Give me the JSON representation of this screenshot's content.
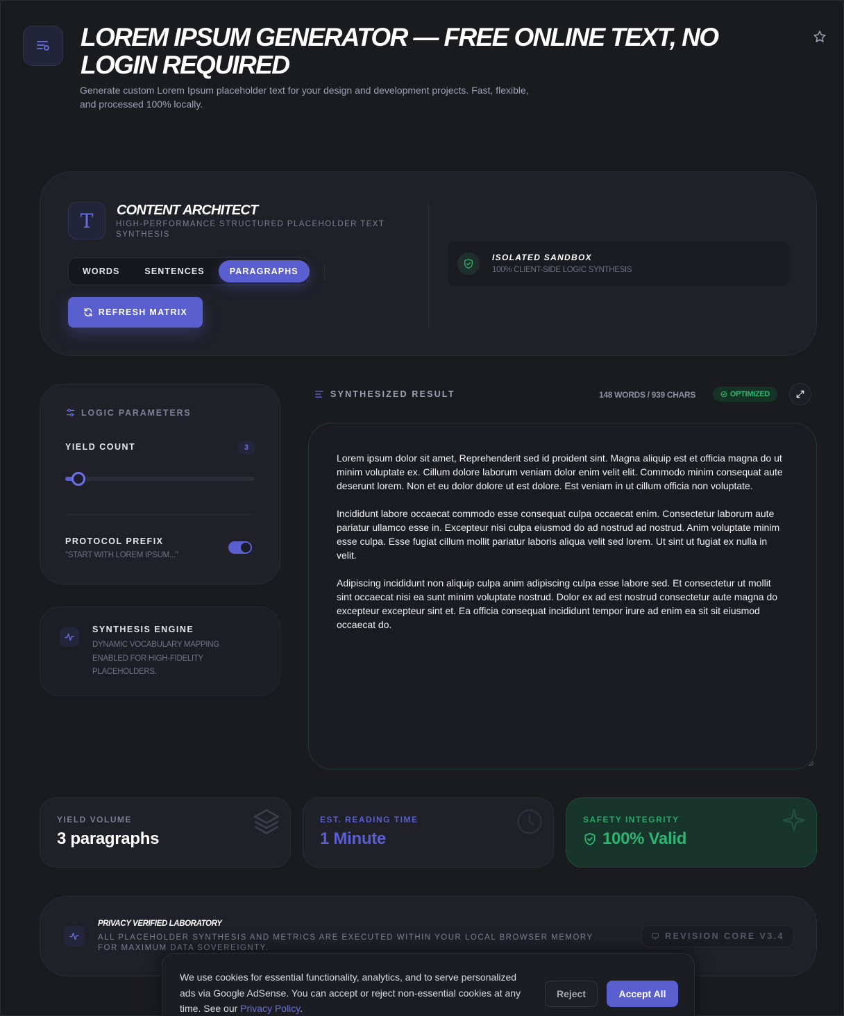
{
  "header": {
    "title": "LOREM IPSUM GENERATOR — FREE ONLINE TEXT, NO LOGIN REQUIRED",
    "subtitle": "Generate custom Lorem Ipsum placeholder text for your design and development projects. Fast, flexible, and processed 100% locally.",
    "menu_icon": "menu-lines-icon",
    "star_icon": "star-icon"
  },
  "architect": {
    "title": "CONTENT ARCHITECT",
    "subtitle": "HIGH-PERFORMANCE STRUCTURED PLACEHOLDER TEXT SYNTHESIS",
    "logo_glyph": "T",
    "tabs": [
      {
        "label": "WORDS",
        "active": false
      },
      {
        "label": "SENTENCES",
        "active": false
      },
      {
        "label": "PARAGRAPHS",
        "active": true
      }
    ],
    "refresh_label": "REFRESH MATRIX",
    "sandbox": {
      "title": "ISOLATED SANDBOX",
      "subtitle": "100% CLIENT-SIDE LOGIC SYNTHESIS"
    }
  },
  "logic": {
    "title": "LOGIC PARAMETERS",
    "yield_label": "YIELD COUNT",
    "yield_value": "3",
    "slider_fraction": 0.07,
    "prefix_label": "PROTOCOL PREFIX",
    "prefix_sub": "\"START WITH LOREM IPSUM...\"",
    "prefix_enabled": true
  },
  "engine": {
    "title": "SYNTHESIS ENGINE",
    "subtitle": "DYNAMIC VOCABULARY MAPPING ENABLED FOR HIGH-FIDELITY PLACEHOLDERS."
  },
  "result": {
    "title": "SYNTHESIZED RESULT",
    "stats": "148 WORDS / 939 CHARS",
    "badge": "OPTIMIZED",
    "paragraphs": [
      "Lorem ipsum dolor sit amet, Reprehenderit sed id proident sint. Magna aliquip est et officia magna do ut minim voluptate ex. Cillum dolore laborum veniam dolor enim velit elit. Commodo minim consequat aute deserunt lorem. Non et eu dolor dolore ut est dolore. Est veniam in ut cillum officia non voluptate.",
      "Incididunt labore occaecat commodo esse consequat culpa occaecat enim. Consectetur laborum aute pariatur ullamco esse in. Excepteur nisi culpa eiusmod do ad nostrud ad nostrud. Anim voluptate minim esse culpa. Esse fugiat cillum mollit pariatur laboris aliqua velit sed lorem. Ut sint ut fugiat ex nulla in velit.",
      "Adipiscing incididunt non aliquip culpa anim adipiscing culpa esse labore sed. Et consectetur ut mollit sint occaecat nisi ea sunt minim voluptate nostrud. Dolor ex ad est nostrud consectetur aute magna do excepteur excepteur sint et. Ea officia consequat incididunt tempor irure ad enim ea sit sit eiusmod occaecat do."
    ]
  },
  "stats": [
    {
      "label": "YIELD VOLUME",
      "value": "3 paragraphs",
      "icon": "layers-icon"
    },
    {
      "label": "EST. READING TIME",
      "value": "1 Minute",
      "icon": "clock-icon"
    },
    {
      "label": "SAFETY INTEGRITY",
      "value": "100% Valid",
      "icon": "sparkle-icon"
    }
  ],
  "footer": {
    "title": "PRIVACY VERIFIED LABORATORY",
    "subtitle": "ALL PLACEHOLDER SYNTHESIS AND METRICS ARE EXECUTED WITHIN YOUR LOCAL BROWSER MEMORY FOR MAXIMUM DATA SOVEREIGNTY.",
    "revision": "REVISION CORE V3.4"
  },
  "cookie": {
    "text": "We use cookies for essential functionality, analytics, and to serve personalized ads via Google AdSense. You can accept or reject non-essential cookies at any time. See our ",
    "link": "Privacy Policy",
    "suffix": ".",
    "reject_label": "Reject",
    "accept_label": "Accept All"
  },
  "colors": {
    "background": "#1a1b1f",
    "accent": "#5a5fd0",
    "success": "#2fb572"
  }
}
